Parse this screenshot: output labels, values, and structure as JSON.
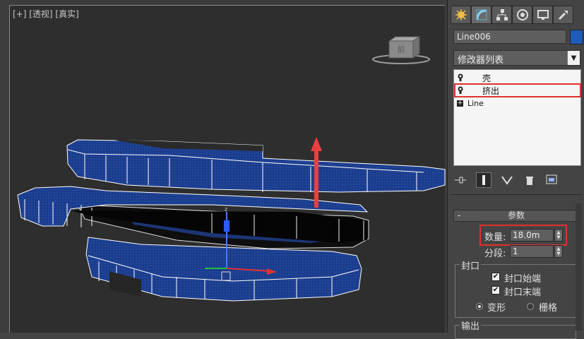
{
  "viewport": {
    "label": "[+] [透视] [真实]",
    "viewcube_label": "前"
  },
  "panel": {
    "tabs": [
      "create-icon",
      "modify-icon",
      "hierarchy-icon",
      "motion-icon",
      "display-icon",
      "utilities-icon"
    ],
    "object_name": "Line006",
    "object_color": "#1f5bb8",
    "modifier_list": "修改器列表",
    "stack": [
      {
        "label": "壳"
      },
      {
        "label": "挤出"
      },
      {
        "label": "Line"
      }
    ],
    "rollout_title": "参数",
    "amount_label": "数量:",
    "amount_value": "18.0m",
    "segments_label": "分段:",
    "segments_value": "1",
    "capping_group": "封口",
    "cap_start": "封口始端",
    "cap_end": "封口末端",
    "morph": "变形",
    "grid": "栅格",
    "output_group": "输出"
  }
}
